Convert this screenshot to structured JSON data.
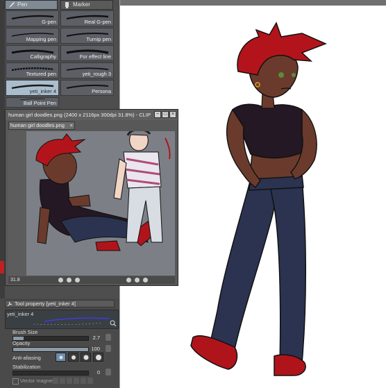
{
  "brush_panel": {
    "tabs": [
      {
        "label": "Pen",
        "icon": "pen-icon",
        "active": true
      },
      {
        "label": "Marker",
        "icon": "marker-icon",
        "active": false
      }
    ],
    "brushes": [
      {
        "label": "G-pen",
        "selected": false
      },
      {
        "label": "Real G-pen",
        "selected": false
      },
      {
        "label": "Mapping pen",
        "selected": false
      },
      {
        "label": "Turnip pen",
        "selected": false
      },
      {
        "label": "Calligraphy",
        "selected": false
      },
      {
        "label": "For effect line",
        "selected": false
      },
      {
        "label": "Textured pen",
        "selected": false
      },
      {
        "label": "yeti_rough 3",
        "selected": false
      },
      {
        "label": "yeti_inker 4",
        "selected": true
      },
      {
        "label": "Persona",
        "selected": false
      },
      {
        "label": "Ball Point Pen",
        "selected": false
      }
    ]
  },
  "sub_window": {
    "title": "human girl doodles.png (2400 x 2116px 300dpi 31.8%) - CLIP",
    "tab_label": "human girl doodles.png",
    "tab_close": "×",
    "zoom": "31.8",
    "buttons": [
      "−",
      "□",
      "×"
    ]
  },
  "tool_property": {
    "header": "Tool property [yeti_inker 4]",
    "brush_name": "yeti_inker 4",
    "brush_size": {
      "label": "Brush Size",
      "value": "2.7",
      "fraction": 0.14
    },
    "opacity": {
      "label": "Opacity",
      "value": "100",
      "fraction": 1.0
    },
    "anti_aliasing": {
      "label": "Anti-aliasing",
      "options": [
        "none",
        "weak",
        "medium",
        "strong"
      ],
      "selected": 0
    },
    "stabilization": {
      "label": "Stabilization",
      "value": "0",
      "fraction": 0.0
    },
    "vector_magnet": {
      "label": "Vector magnet",
      "checked": false
    }
  },
  "colors": {
    "panel_bg": "#4e4e4e",
    "selected_brush": "#aabdcc",
    "hair": "#b3141b",
    "skin": "#6a3b2c",
    "jeans": "#2b3350",
    "shirt": "#231824",
    "shoes": "#b0141b"
  }
}
